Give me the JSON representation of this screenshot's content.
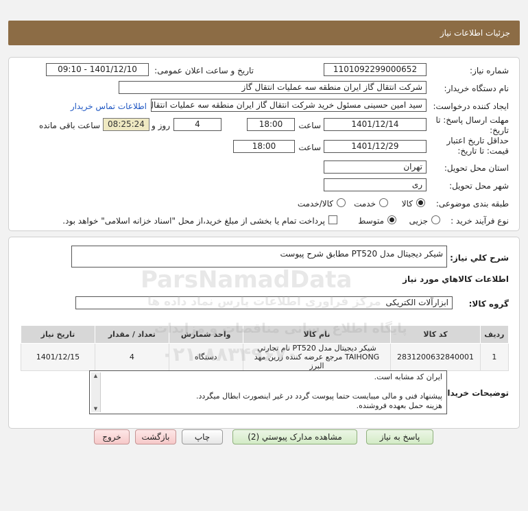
{
  "header": {
    "title": "جزئیات اطلاعات نیاز"
  },
  "form": {
    "need_number_label": "شماره نیاز:",
    "need_number": "1101092299000652",
    "announce_label": "تاریخ و ساعت اعلان عمومی:",
    "announce_value": "1401/12/10 - 09:10",
    "buyer_org_label": "نام دستگاه خریدار:",
    "buyer_org": "شرکت انتقال گاز ایران منطقه سه عملیات انتقال گاز",
    "requester_label": "ایجاد کننده درخواست:",
    "requester": "سید امین حسینی مسئول خرید شرکت انتقال گاز ایران منطقه سه عملیات انتقال",
    "buyer_contact_link": "اطلاعات تماس خریدار",
    "reply_deadline_label": "مهلت ارسال پاسخ: تا تاریخ:",
    "reply_date": "1401/12/14",
    "time_label": "ساعت",
    "reply_time": "18:00",
    "days_value": "4",
    "days_label": "روز و",
    "remaining_time": "08:25:24",
    "remaining_label": "ساعت باقی مانده",
    "validity_label": "حداقل تاریخ اعتبار قیمت: تا تاریخ:",
    "validity_date": "1401/12/29",
    "validity_time": "18:00",
    "province_label": "استان محل تحویل:",
    "province": "تهران",
    "city_label": "شهر محل تحویل:",
    "city": "ری",
    "category_label": "طبقه بندی موضوعی:",
    "category_options": [
      "کالا",
      "خدمت",
      "کالا/خدمت"
    ],
    "process_label": "نوع فرآیند خرید :",
    "process_options": [
      "جزیی",
      "متوسط"
    ],
    "treasury_note": "پرداخت تمام یا بخشی از مبلغ خرید،از محل \"اسناد خزانه اسلامی\" خواهد بود."
  },
  "summary": {
    "label": "شرح کلي نياز:",
    "value": "شیکر دیجیتال مدل PT520 مطابق شرح پیوست"
  },
  "goods": {
    "section_title": "اطلاعات کالاهاي مورد نياز",
    "group_label": "گروه کالا:",
    "group_value": "ابزارآلات الکتریکی",
    "columns": [
      "ردیف",
      "کد کالا",
      "نام کالا",
      "واحد شمارش",
      "تعداد / مقدار",
      "تاریخ نیاز"
    ],
    "rows": [
      {
        "row": "1",
        "code": "2831200632840001",
        "name": "شیکر دیجیتال مدل PT520 نام تجارتي TAIHONG مرجع عرضه کننده زرین مهد البرز",
        "unit": "دستگاه",
        "qty": "4",
        "date": "1401/12/15"
      }
    ]
  },
  "buyer_notes": {
    "label": "توضیحات خریدار:",
    "lines": [
      "ایران کد مشابه است.",
      "",
      "پیشنهاد فنی و مالی میبایست حتما پیوست گردد در غیر اینصورت ابطال میگردد.",
      "هزینه حمل بعهده فروشنده."
    ]
  },
  "buttons": {
    "reply": "پاسخ به نیاز",
    "attachments": "مشاهده مدارک پیوستي (2)",
    "print": "چاپ",
    "back": "بازگشت",
    "exit": "خروج"
  },
  "watermark": {
    "brand": "ParsNamadData",
    "line1": "مرکز فراوری اطلاعات پارس نماد داده ها",
    "line2": "پایگاه اطلاع رسانی مناقصات و مزایدات",
    "phone": "۰۲۱-۸۸۳۴۹۶۷۰"
  },
  "colors": {
    "header_bg": "#8c6c45",
    "link": "#1f57c3",
    "remaining_bg": "#efe9c2"
  }
}
